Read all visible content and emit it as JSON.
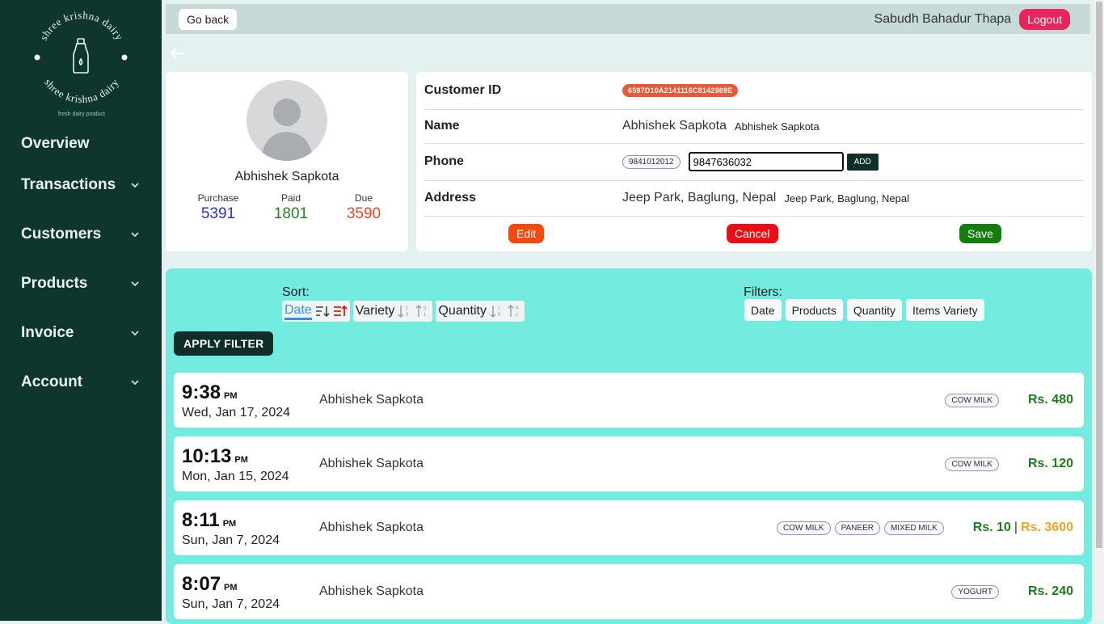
{
  "brand": {
    "top_text": "shree krishna dairy",
    "bottom_text": "shree krishna dairy",
    "tagline": "fresh dairy product"
  },
  "sidebar": {
    "items": [
      {
        "label": "Overview",
        "has_chevron": false
      },
      {
        "label": "Transactions",
        "has_chevron": true
      },
      {
        "label": "Customers",
        "has_chevron": true
      },
      {
        "label": "Products",
        "has_chevron": true
      },
      {
        "label": "Invoice",
        "has_chevron": true
      },
      {
        "label": "Account",
        "has_chevron": true
      }
    ]
  },
  "topbar": {
    "go_back": "Go back",
    "username": "Sabudh Bahadur Thapa",
    "logout": "Logout"
  },
  "profile": {
    "name": "Abhishek Sapkota",
    "purchase_label": "Purchase",
    "purchase_value": "5391",
    "paid_label": "Paid",
    "paid_value": "1801",
    "due_label": "Due",
    "due_value": "3590"
  },
  "details": {
    "customer_id_label": "Customer ID",
    "customer_id": "6597D10A2141116C8142989E",
    "name_label": "Name",
    "name_value": "Abhishek Sapkota",
    "name_value_small": "Abhishek Sapkota",
    "phone_label": "Phone",
    "phone_chip": "9841012012",
    "phone_input_value": "9847636032",
    "add_label": "ADD",
    "address_label": "Address",
    "address_value": "Jeep Park, Baglung, Nepal",
    "address_value_small": "Jeep Park, Baglung, Nepal",
    "edit_label": "Edit",
    "cancel_label": "Cancel",
    "save_label": "Save"
  },
  "sort": {
    "label": "Sort:",
    "options": [
      "Date",
      "Variety",
      "Quantity"
    ],
    "active": "Date"
  },
  "filters": {
    "label": "Filters:",
    "options": [
      "Date",
      "Products",
      "Quantity",
      "Items Variety"
    ]
  },
  "apply_filter": "APPLY FILTER",
  "transactions": [
    {
      "time": "9:38",
      "ampm": "PM",
      "date": "Wed, Jan 17, 2024",
      "name": "Abhishek Sapkota",
      "items": [
        "COW MILK"
      ],
      "amount": "Rs. 480",
      "amount2": ""
    },
    {
      "time": "10:13",
      "ampm": "PM",
      "date": "Mon, Jan 15, 2024",
      "name": "Abhishek Sapkota",
      "items": [
        "COW MILK"
      ],
      "amount": "Rs. 120",
      "amount2": ""
    },
    {
      "time": "8:11",
      "ampm": "PM",
      "date": "Sun, Jan 7, 2024",
      "name": "Abhishek Sapkota",
      "items": [
        "COW MILK",
        "PANEER",
        "MIXED MILK"
      ],
      "amount": "Rs. 10",
      "amount2": "Rs. 3600"
    },
    {
      "time": "8:07",
      "ampm": "PM",
      "date": "Sun, Jan 7, 2024",
      "name": "Abhishek Sapkota",
      "items": [
        "YOGURT"
      ],
      "amount": "Rs. 240",
      "amount2": ""
    }
  ],
  "colors": {
    "sidebar_bg": "#0f352f",
    "panel_bg": "#73ebdf",
    "purchase": "#2b2fd1",
    "paid": "#2a7a2a",
    "due": "#e8462b",
    "amount": "#1f7a1f",
    "amount_secondary": "#f0a32c"
  }
}
